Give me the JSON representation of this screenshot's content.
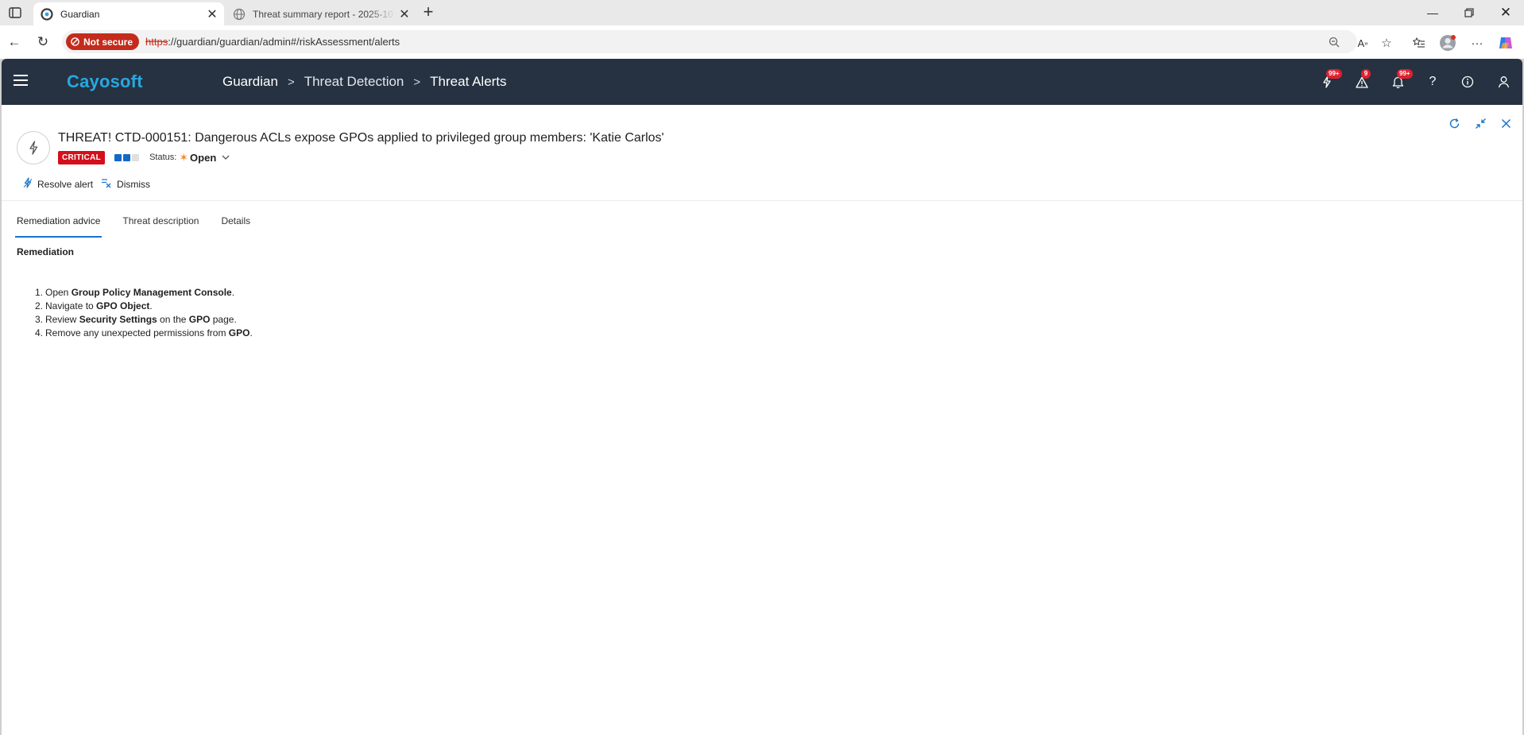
{
  "browser": {
    "tabs": [
      {
        "title": "Guardian",
        "active": true,
        "favicon": "cayosoft-icon"
      },
      {
        "title": "Threat summary report - 2025-10",
        "active": false,
        "favicon": "globe-icon"
      }
    ],
    "not_secure_label": "Not secure",
    "url_scheme": "https",
    "url_rest": "://guardian/guardian/admin#/riskAssessment/alerts"
  },
  "app": {
    "brand": "Cayosoft",
    "breadcrumb": [
      "Guardian",
      "Threat Detection",
      "Threat Alerts"
    ],
    "header_badges": {
      "threats": "99+",
      "warnings": "9",
      "notifications": "99+"
    }
  },
  "alert": {
    "title": "THREAT! CTD-000151: Dangerous ACLs expose GPOs applied to privileged group members: 'Katie Carlos'",
    "severity_label": "CRITICAL",
    "severity_level": 2,
    "severity_max": 3,
    "status_label": "Status:",
    "status_value": "Open",
    "actions": {
      "resolve": "Resolve alert",
      "dismiss": "Dismiss"
    }
  },
  "panel_tabs": [
    "Remediation advice",
    "Threat description",
    "Details"
  ],
  "remediation": {
    "title": "Remediation",
    "steps": [
      {
        "num": "1.",
        "parts": [
          {
            "t": "Open "
          },
          {
            "t": "Group Policy Management Console",
            "b": true
          },
          {
            "t": "."
          }
        ]
      },
      {
        "num": "2.",
        "parts": [
          {
            "t": "Navigate to "
          },
          {
            "t": "GPO Object",
            "b": true
          },
          {
            "t": "."
          }
        ]
      },
      {
        "num": "3.",
        "parts": [
          {
            "t": "Review "
          },
          {
            "t": "Security Settings",
            "b": true
          },
          {
            "t": " on the "
          },
          {
            "t": "GPO",
            "b": true
          },
          {
            "t": " page."
          }
        ]
      },
      {
        "num": "4.",
        "parts": [
          {
            "t": "Remove any unexpected permissions from "
          },
          {
            "t": "GPO",
            "b": true
          },
          {
            "t": "."
          }
        ]
      }
    ]
  },
  "colors": {
    "header_bg": "#263241",
    "brand": "#27a8e0",
    "accent": "#1a73c8",
    "critical": "#d40f1c",
    "status_star": "#f08a24"
  }
}
